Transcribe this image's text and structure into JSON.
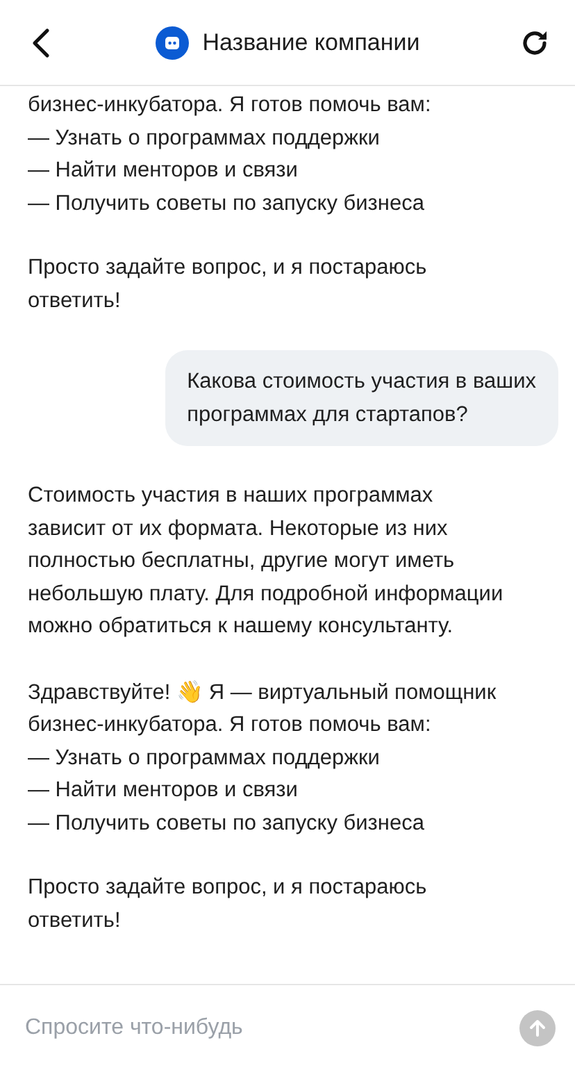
{
  "header": {
    "title": "Название компании"
  },
  "messages": [
    {
      "kind": "bot",
      "paragraphs": [
        "бизнес-инкубатора. Я готов помочь вам:\n— Узнать о программах поддержки\n— Найти менторов и связи\n— Получить советы по запуску бизнеса",
        "Просто задайте вопрос, и я постараюсь\nответить!"
      ]
    },
    {
      "kind": "user",
      "paragraphs": [
        "Какова стоимость участия в ваших\nпрограммах для стартапов?"
      ]
    },
    {
      "kind": "bot",
      "paragraphs": [
        "Стоимость участия в наших программах\nзависит от их формата. Некоторые из них\nполностью бесплатны, другие могут иметь\nнебольшую плату. Для подробной информации\nможно обратиться к нашему консультанту."
      ]
    },
    {
      "kind": "bot",
      "paragraphs": [
        "Здравствуйте! 👋 Я — виртуальный помощник\nбизнес-инкубатора. Я готов помочь вам:\n— Узнать о программах поддержки\n— Найти менторов и связи\n— Получить советы по запуску бизнеса",
        "Просто задайте вопрос, и я постараюсь\nответить!"
      ]
    }
  ],
  "composer": {
    "placeholder": "Спросите что-нибудь"
  }
}
